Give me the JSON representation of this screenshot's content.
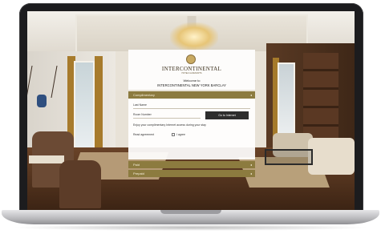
{
  "portal": {
    "brand": "INTERCONTINENTAL",
    "brand_sub": "HOTELS & RESORTS",
    "welcome": "Welcome to",
    "hotel_name": "INTERCONTINENTAL NEW YORK BARCLAY"
  },
  "tabs": {
    "complimentary": "Complimentary",
    "paid": "Paid",
    "prepaid": "Prepaid"
  },
  "form": {
    "last_name_placeholder": "Last Name",
    "room_number_placeholder": "Room Number",
    "go_button": "Go to Internet",
    "info_text": "Enjoy your complimentary Internet access during your stay",
    "agreement_label": "Read agreement",
    "agree_label": "I agree"
  },
  "colors": {
    "tab_gold": "#8c7b3f",
    "button_dark": "#2d2d2d"
  }
}
